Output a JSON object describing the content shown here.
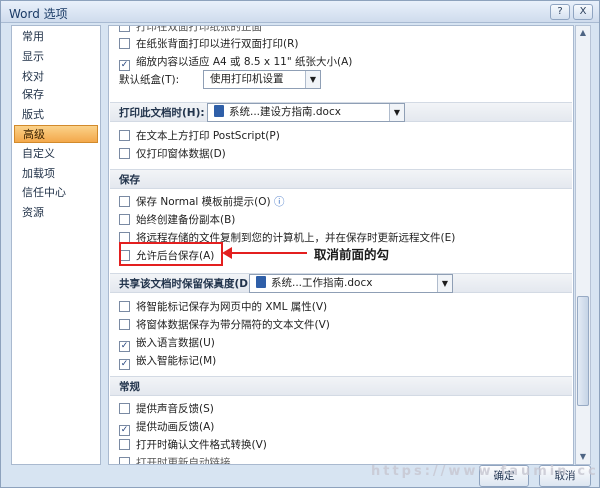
{
  "window": {
    "title": "Word 选项"
  },
  "titlebar_buttons": {
    "help": "?",
    "close": "X"
  },
  "sidebar": {
    "items": [
      {
        "label": "常用"
      },
      {
        "label": "显示"
      },
      {
        "label": "校对"
      },
      {
        "label": "保存"
      },
      {
        "label": "版式"
      },
      {
        "label": "高级",
        "active": true
      },
      {
        "label": "自定义"
      },
      {
        "label": "加载项"
      },
      {
        "label": "信任中心"
      },
      {
        "label": "资源"
      }
    ]
  },
  "print_section": {
    "cut_off_label": "打印在双面打印纸张的正面",
    "options": [
      {
        "label": "在纸张背面打印以进行双面打印(R)",
        "checked": false
      },
      {
        "label": "缩放内容以适应 A4 或 8.5 x 11\" 纸张大小(A)",
        "checked": true
      }
    ],
    "default_tray_label": "默认纸盒(T):",
    "default_tray_value": "使用打印机设置"
  },
  "print_doc_section": {
    "title": "打印此文档时(H):",
    "doc_value": "系统...建设方指南.docx",
    "options": [
      {
        "label": "在文本上方打印 PostScript(P)",
        "checked": false
      },
      {
        "label": "仅打印窗体数据(D)",
        "checked": false
      }
    ]
  },
  "save_section": {
    "title": "保存",
    "options": [
      {
        "label": "保存 Normal 模板前提示(O)",
        "checked": false,
        "info": "ⓘ"
      },
      {
        "label": "始终创建备份副本(B)",
        "checked": false
      },
      {
        "label": "将远程存储的文件复制到您的计算机上，并在保存时更新远程文件(E)",
        "checked": false
      },
      {
        "label": "允许后台保存(A)",
        "checked": false
      }
    ]
  },
  "annotation": {
    "text": "取消前面的勾"
  },
  "fidelity_section": {
    "title": "共享该文档时保留保真度(D):",
    "doc_value": "系统...工作指南.docx",
    "options": [
      {
        "label": "将智能标记保存为网页中的 XML 属性(V)",
        "checked": false
      },
      {
        "label": "将窗体数据保存为带分隔符的文本文件(V)",
        "checked": false
      },
      {
        "label": "嵌入语言数据(U)",
        "checked": true
      },
      {
        "label": "嵌入智能标记(M)",
        "checked": true
      }
    ]
  },
  "general_section": {
    "title": "常规",
    "options": [
      {
        "label": "提供声音反馈(S)",
        "checked": false
      },
      {
        "label": "提供动画反馈(A)",
        "checked": true
      },
      {
        "label": "打开时确认文件格式转换(V)",
        "checked": false
      },
      {
        "label": "打开时更新自动链接",
        "checked": false
      }
    ]
  },
  "footer": {
    "ok": "确定",
    "cancel": "取消"
  },
  "watermark": "https://www.faumin.cc",
  "colors": {
    "accent": "#f3a84b",
    "annotation": "#e31f1f"
  }
}
